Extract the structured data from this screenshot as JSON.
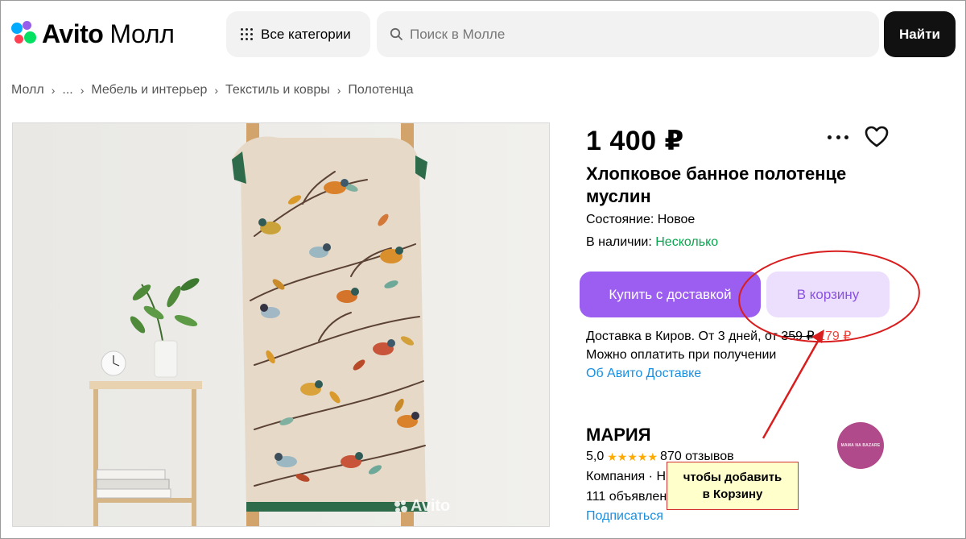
{
  "header": {
    "brand": "Avito",
    "brand_suffix": "Молл",
    "categories_label": "Все категории",
    "search_placeholder": "Поиск в Молле",
    "search_button": "Найти"
  },
  "breadcrumb": [
    "Молл",
    "...",
    "Мебель и интерьер",
    "Текстиль и ковры",
    "Полотенца"
  ],
  "product": {
    "price": "1 400 ₽",
    "title": "Хлопковое банное полотенце муслин",
    "condition_label": "Состояние:",
    "condition_value": "Новое",
    "stock_label": "В наличии:",
    "stock_value": "Несколько",
    "photo_watermark": "Avito"
  },
  "actions": {
    "buy_delivery": "Купить с доставкой",
    "add_to_cart": "В корзину"
  },
  "delivery": {
    "text": "Доставка в Киров. От 3 дней, от",
    "old_price": "359 ₽",
    "new_price": "179 ₽",
    "pay_on_receipt": "Можно оплатить при получении",
    "about_link": "Об Авито Доставке"
  },
  "seller": {
    "name": "МАРИЯ",
    "rating": "5,0",
    "stars": "★★★★★",
    "reviews": "870 отзывов",
    "company": "Компания · Н",
    "ads": "111 объявлен",
    "subscribe": "Подписаться",
    "avatar_text": "MAMA NA BAZARE"
  },
  "annotation": {
    "text_line1": "чтобы добавить",
    "text_line2": "в Корзину"
  },
  "colors": {
    "accent_purple": "#9b5ef0",
    "cart_bg": "#ecdffd",
    "link_blue": "#1a8fe0",
    "in_stock_green": "#0aa34f",
    "sale_red": "#f0463c",
    "annotation_red": "#d81e1e"
  }
}
